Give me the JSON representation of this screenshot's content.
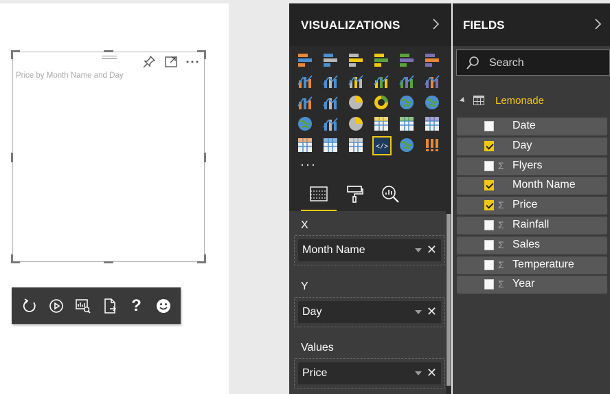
{
  "canvas": {
    "visual_title": "Price by Month Name and Day"
  },
  "toolbar": {
    "icons": [
      "refresh-icon",
      "play-icon",
      "chart-search-icon",
      "export-icon",
      "help-icon",
      "smiley-icon"
    ],
    "help_glyph": "?"
  },
  "visualizations": {
    "title": "VISUALIZATIONS",
    "more": "···",
    "icons": [
      "stacked-bar-icon",
      "stacked-column-icon",
      "clustered-bar-icon",
      "clustered-column-icon",
      "100-bar-icon",
      "100-column-icon",
      "line-chart-icon",
      "area-chart-icon",
      "stacked-area-icon",
      "line-column-icon",
      "line-clustered-column-icon",
      "ribbon-chart-icon",
      "waterfall-icon",
      "scatter-icon",
      "pie-icon",
      "donut-icon",
      "treemap-icon",
      "map-icon",
      "filled-map-icon",
      "funnel-icon",
      "gauge-icon",
      "card-icon",
      "multirow-card-icon",
      "kpi-icon",
      "slicer-icon",
      "table-icon",
      "matrix-icon",
      "custom-visual-icon",
      "globe-icon",
      "exclamation-icon"
    ],
    "selected_icon_index": 27,
    "tabs": [
      "fields-tab",
      "format-tab",
      "analytics-tab"
    ],
    "wells": [
      {
        "label": "X",
        "field": "Month Name"
      },
      {
        "label": "Y",
        "field": "Day"
      },
      {
        "label": "Values",
        "field": "Price"
      }
    ],
    "remove_glyph": "✕"
  },
  "fields": {
    "title": "FIELDS",
    "search_placeholder": "Search",
    "table_name": "Lemonade",
    "items": [
      {
        "name": "Date",
        "checked": false,
        "sigma": false
      },
      {
        "name": "Day",
        "checked": true,
        "sigma": false
      },
      {
        "name": "Flyers",
        "checked": false,
        "sigma": true
      },
      {
        "name": "Month Name",
        "checked": true,
        "sigma": false
      },
      {
        "name": "Price",
        "checked": true,
        "sigma": true
      },
      {
        "name": "Rainfall",
        "checked": false,
        "sigma": true
      },
      {
        "name": "Sales",
        "checked": false,
        "sigma": true
      },
      {
        "name": "Temperature",
        "checked": false,
        "sigma": true
      },
      {
        "name": "Year",
        "checked": false,
        "sigma": true
      }
    ],
    "sigma_glyph": "Σ"
  },
  "colors": {
    "accent": "#f2c811",
    "pane_dark": "#2a2a2a"
  }
}
